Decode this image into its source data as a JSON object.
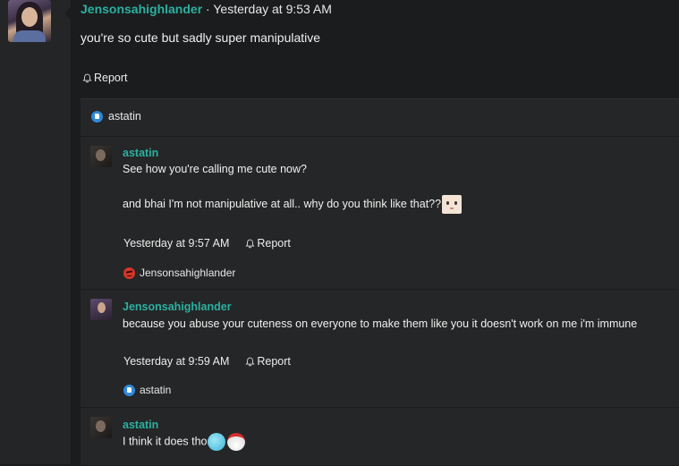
{
  "post": {
    "author": "Jensonsahighlander",
    "separator": " · ",
    "time": "Yesterday at 9:53 AM",
    "body": "you're so cute but sadly super manipulative",
    "report_label": "Report"
  },
  "likes": {
    "user": "astatin"
  },
  "replies": [
    {
      "author": "astatin",
      "line1": "See how you're calling me cute now?",
      "line2": "and bhai I'm not manipulative at all.. why do you think like that??",
      "time": "Yesterday at 9:57 AM",
      "report_label": "Report",
      "reaction_user": "Jensonsahighlander"
    },
    {
      "author": "Jensonsahighlander",
      "line1": "because you abuse your cuteness on everyone to make them like you it doesn't work on me i'm immune",
      "time": "Yesterday at 9:59 AM",
      "report_label": "Report",
      "reaction_user": "astatin"
    },
    {
      "author": "astatin",
      "line1": "I think it does tho"
    }
  ],
  "colors": {
    "accent": "#2bb0a0",
    "background": "#1b1c1d",
    "panel": "#252627",
    "like": "#2e89d9",
    "angry": "#d5352a"
  }
}
